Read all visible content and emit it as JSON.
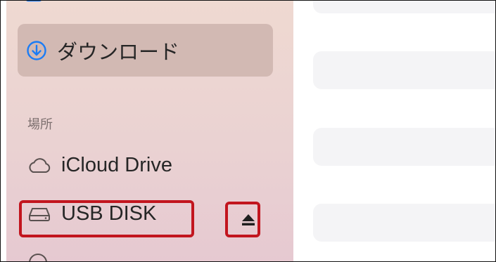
{
  "sidebar": {
    "items": {
      "downloads": {
        "label": "ダウンロード",
        "selected": true,
        "icon": "arrow-down-circle-icon"
      },
      "icloud": {
        "label": "iCloud Drive",
        "icon": "cloud-icon"
      },
      "usb": {
        "label": "USB DISK",
        "icon": "external-drive-icon",
        "eject_icon": "eject-icon"
      }
    },
    "section_locations": "場所"
  },
  "colors": {
    "accent": "#1b7cf5",
    "highlight_annotation": "#c2151e",
    "selected_bg": "#d2b9b3"
  }
}
